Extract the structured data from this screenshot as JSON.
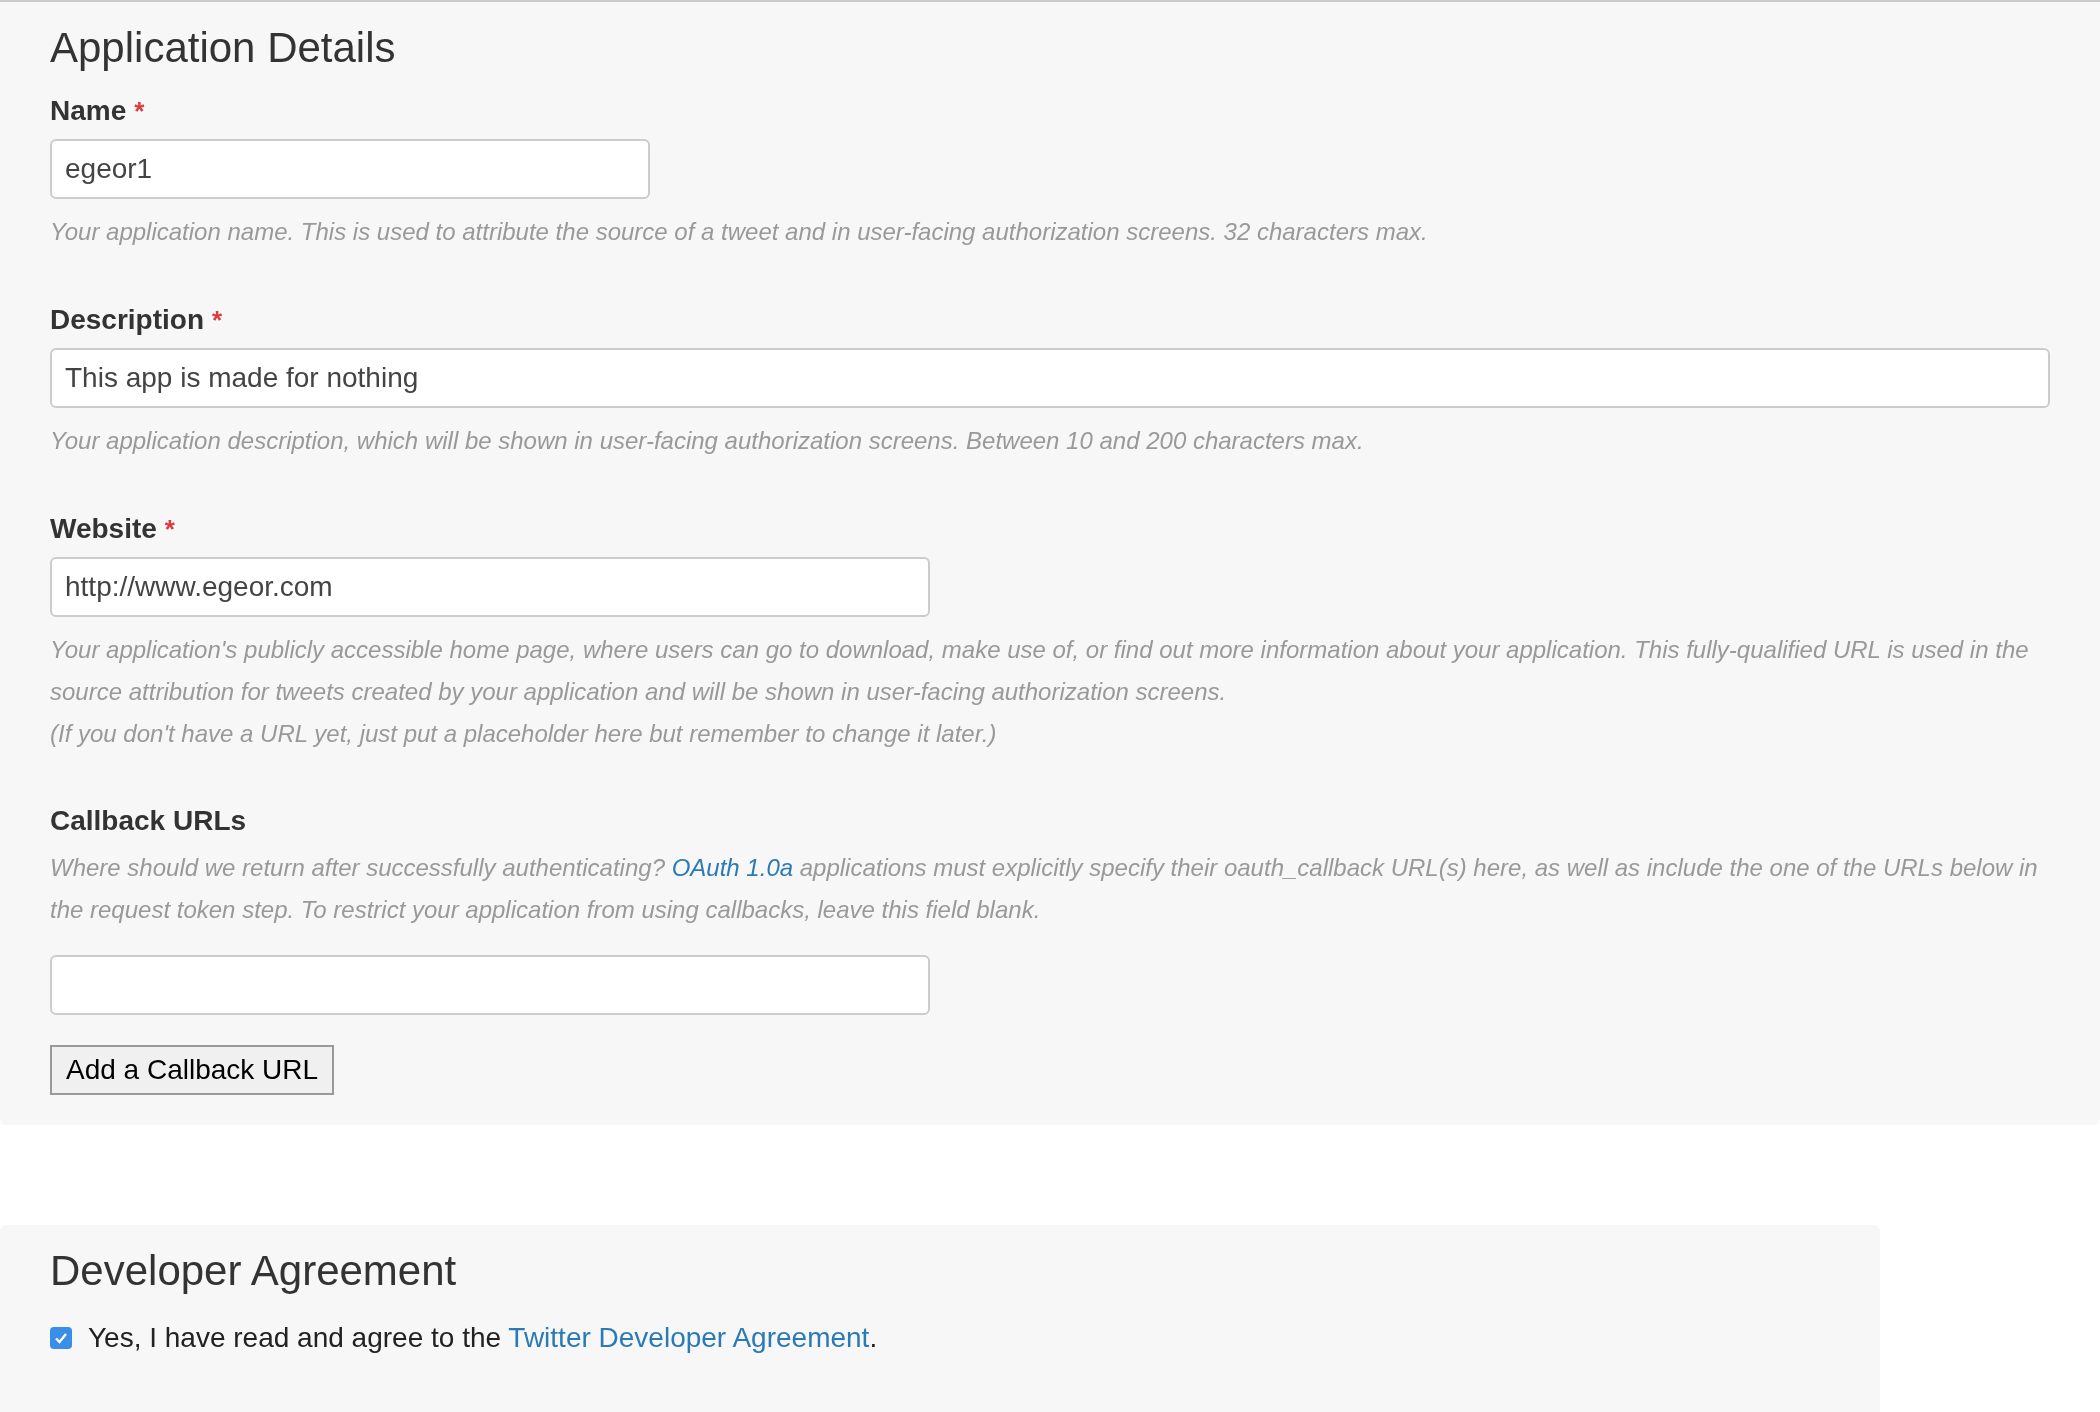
{
  "application_details": {
    "title": "Application Details",
    "fields": [
      {
        "kind": "input",
        "label": "Name",
        "marker": "*",
        "value": "egeor1",
        "help": [
          {
            "before": "Your application name. This is used to attribute the source of a tweet and in user-facing authorization screens. 32 characters max."
          }
        ]
      },
      {
        "kind": "input",
        "label": "Description",
        "marker": "*",
        "value": "This app is made for nothing",
        "help": [
          {
            "before": "Your application description, which will be shown in user-facing authorization screens. Between 10 and 200 characters max."
          }
        ]
      },
      {
        "kind": "input",
        "label": "Website",
        "marker": "*",
        "value": "http://www.egeor.com",
        "help": [
          {
            "before": "Your application's publicly accessible home page, where users can go to download, make use of, or find out more information about your application. This fully-qualified URL is used in the source attribution for tweets created by your application and will be shown in user-facing authorization screens."
          },
          {
            "before": "(If you don't have a URL yet, just put a placeholder here but remember to change it later.)"
          }
        ]
      },
      {
        "kind": "callbacks",
        "label": "Callback URLs",
        "help": [
          {
            "before": "Where should we return after successfully authenticating? ",
            "link": "OAuth 1.0a",
            "after": " applications must explicitly specify their oauth_callback URL(s) here, as well as include the one of the URLs below in the request token step. To restrict your application from using callbacks, leave this field blank."
          }
        ],
        "button": "Add a Callback URL"
      }
    ]
  },
  "developer_agreement": {
    "title": "Developer Agreement",
    "checked": true,
    "text_before": "Yes, I have read and agree to the ",
    "link": "Twitter Developer Agreement",
    "text_after": "."
  }
}
